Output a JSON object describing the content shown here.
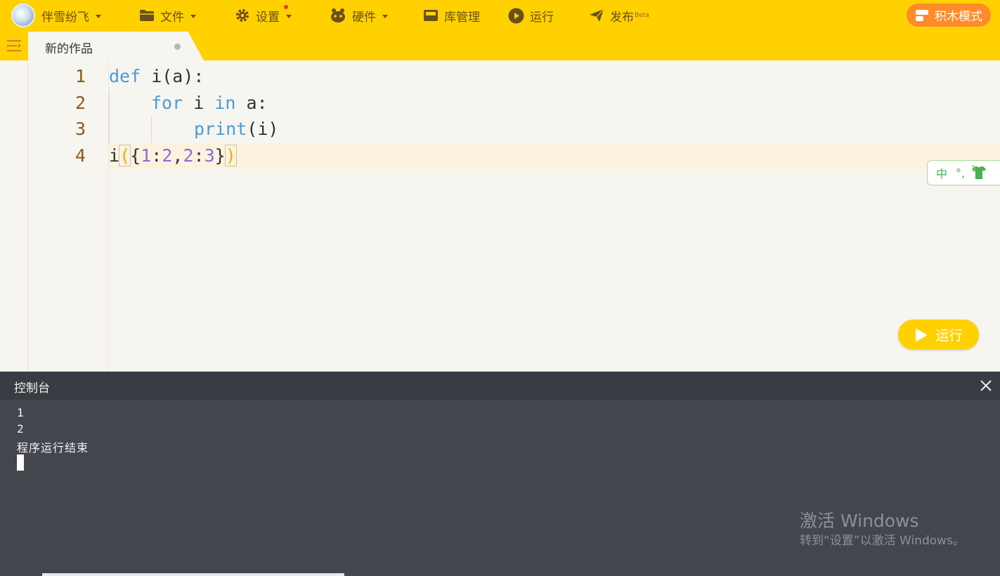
{
  "topbar": {
    "user_name": "伴雪纷飞",
    "menus": [
      {
        "label": "文件",
        "icon": "folder-icon"
      },
      {
        "label": "设置",
        "icon": "gear-icon"
      },
      {
        "label": "硬件",
        "icon": "robot-icon"
      },
      {
        "label": "库管理",
        "icon": "archive-icon"
      },
      {
        "label": "运行",
        "icon": "play-circle-icon"
      },
      {
        "label": "发布",
        "icon": "send-icon",
        "badge": "Beta"
      }
    ],
    "mode_button": "积木模式",
    "accent_color": "#ffd100",
    "mode_button_color": "#ff8a2a"
  },
  "tab": {
    "title": "新的作品"
  },
  "editor": {
    "line_numbers": [
      "1",
      "2",
      "3",
      "4"
    ],
    "lines": [
      [
        "def",
        " i(a):"
      ],
      [
        "for",
        " i ",
        "in",
        " a:"
      ],
      [
        "print",
        "(i)"
      ],
      [
        "i",
        "(",
        "{",
        "1",
        ":",
        "2",
        ",",
        "2",
        ":",
        "3",
        "}",
        ")"
      ]
    ]
  },
  "ime": {
    "mode": "中",
    "punct": "°,"
  },
  "run_button": "运行",
  "console": {
    "title": "控制台",
    "output": [
      "1",
      "2",
      "程序运行结束"
    ]
  },
  "watermark": {
    "line1": "激活 Windows",
    "line2": "转到“设置”以激活 Windows。"
  }
}
